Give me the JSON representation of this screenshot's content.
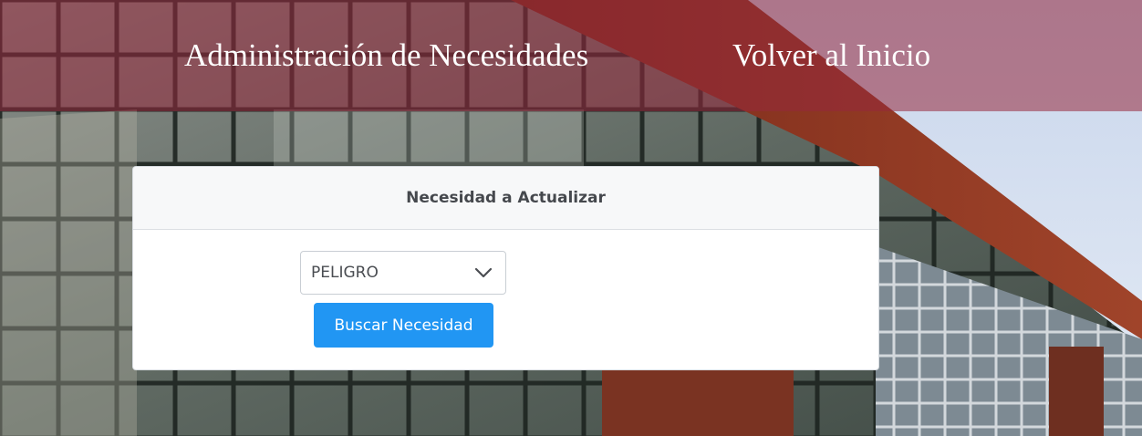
{
  "nav": {
    "admin_label": "Administración de Necesidades",
    "home_label": "Volver al Inicio"
  },
  "card": {
    "title": "Necesidad a Actualizar",
    "select": {
      "selected": "PELIGRO"
    },
    "search_button": "Buscar Necesidad"
  },
  "colors": {
    "nav_overlay": "#96283C",
    "button": "#2196F3",
    "card_header": "#F7F8F9"
  },
  "icons": {
    "select_arrow": "chevron-down-icon"
  }
}
